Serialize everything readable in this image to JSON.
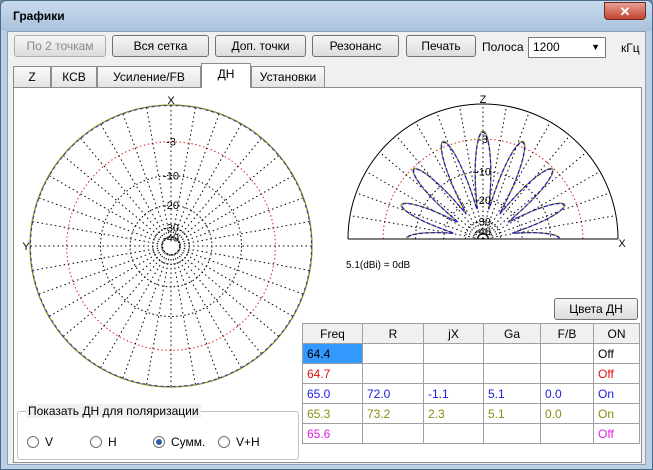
{
  "window": {
    "title": "Графики",
    "close": "✕"
  },
  "toolbar": {
    "btn_two_points": "По 2 точкам",
    "btn_full_grid": "Вся сетка",
    "btn_extra_points": "Доп. точки",
    "btn_resonance": "Резонанс",
    "btn_print": "Печать",
    "band_label": "Полоса",
    "band_value": "1200",
    "band_unit": "кГц"
  },
  "tabs": [
    {
      "label": "Z"
    },
    {
      "label": "КСВ"
    },
    {
      "label": "Усиление/FB"
    },
    {
      "label": "ДН"
    },
    {
      "label": "Установки"
    }
  ],
  "plot": {
    "h_axis_x": "X",
    "h_axis_y": "Y",
    "h_levels": [
      "-3",
      "-10",
      "-20",
      "-30",
      "-40"
    ],
    "v_axis_z": "Z",
    "v_axis_x": "X",
    "v_levels": [
      "-3",
      "-10",
      "-20",
      "-30",
      "-40"
    ],
    "scale_note": "5.1(dBi) = 0dB"
  },
  "colors_button": "Цвета ДН",
  "table": {
    "headers": [
      "Freq",
      "R",
      "jX",
      "Ga",
      "F/B",
      "ON"
    ],
    "rows": [
      {
        "freq": "64.4",
        "r": "",
        "jx": "",
        "ga": "",
        "fb": "",
        "on": "Off",
        "color": "#000000"
      },
      {
        "freq": "64.7",
        "r": "",
        "jx": "",
        "ga": "",
        "fb": "",
        "on": "Off",
        "color": "#e01010"
      },
      {
        "freq": "65.0",
        "r": "72.0",
        "jx": "-1.1",
        "ga": "5.1",
        "fb": "0.0",
        "on": "On",
        "color": "#1a1adc"
      },
      {
        "freq": "65.3",
        "r": "73.2",
        "jx": "2.3",
        "ga": "5.1",
        "fb": "0.0",
        "on": "On",
        "color": "#8c8c10"
      },
      {
        "freq": "65.6",
        "r": "",
        "jx": "",
        "ga": "",
        "fb": "",
        "on": "Off",
        "color": "#e020e0"
      }
    ]
  },
  "polarization": {
    "legend": "Показать ДН для поляризации",
    "options": [
      "V",
      "H",
      "Сумм.",
      "V+H"
    ],
    "selected": "Сумм."
  }
}
